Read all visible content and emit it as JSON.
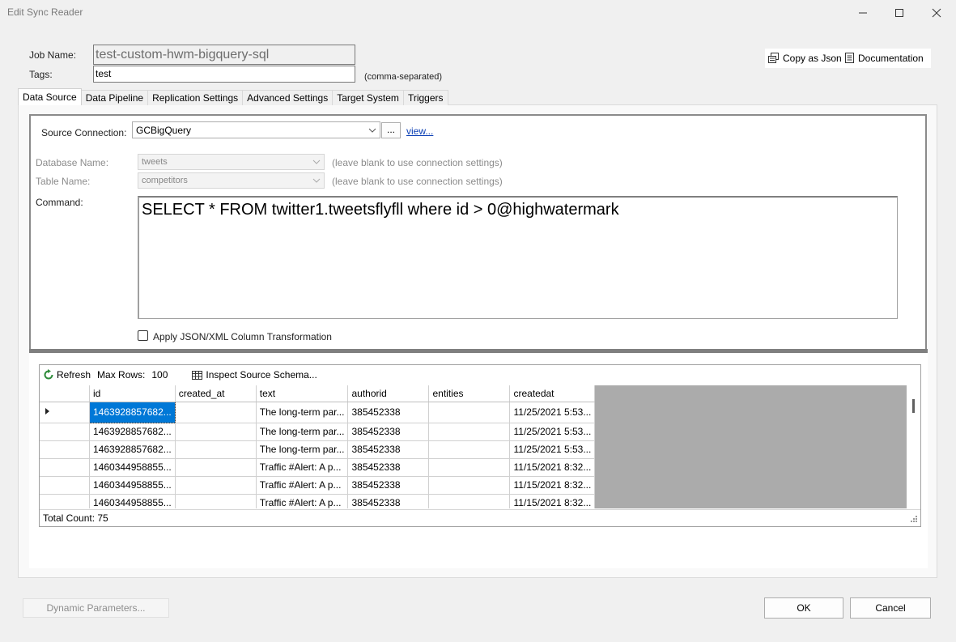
{
  "window": {
    "title": "Edit Sync Reader"
  },
  "header": {
    "job_name_label": "Job Name:",
    "job_name_value": "test-custom-hwm-bigquery-sql",
    "tags_label": "Tags:",
    "tags_value": "test",
    "tags_hint": "(comma-separated)",
    "copy_json_label": "Copy as Json",
    "documentation_label": "Documentation"
  },
  "tabs": [
    {
      "label": "Data Source",
      "active": true
    },
    {
      "label": "Data Pipeline",
      "active": false
    },
    {
      "label": "Replication Settings",
      "active": false
    },
    {
      "label": "Advanced Settings",
      "active": false
    },
    {
      "label": "Target System",
      "active": false
    },
    {
      "label": "Triggers",
      "active": false
    }
  ],
  "data_source": {
    "source_connection_label": "Source Connection:",
    "source_connection_value": "GCBigQuery",
    "browse_button": "...",
    "view_link": "view...",
    "database_name_label": "Database Name:",
    "database_name_value": "tweets",
    "database_hint": "(leave blank to use connection settings)",
    "table_name_label": "Table Name:",
    "table_name_value": "competitors",
    "table_hint": "(leave blank to use connection settings)",
    "command_label": "Command:",
    "command_value": "SELECT * FROM twitter1.tweetsflyfll where id > 0@highwatermark",
    "transform_checkbox_label": "Apply JSON/XML Column Transformation",
    "transform_checked": false
  },
  "grid_toolbar": {
    "refresh_label": "Refresh",
    "max_rows_label": "Max Rows:",
    "max_rows_value": "100",
    "inspect_label": "Inspect Source Schema..."
  },
  "grid": {
    "columns": [
      "id",
      "created_at",
      "text",
      "authorid",
      "entities",
      "createdat"
    ],
    "rows": [
      [
        "1463928857682...",
        "",
        "The long-term par...",
        "385452338",
        "",
        "11/25/2021 5:53..."
      ],
      [
        "1463928857682...",
        "",
        "The long-term par...",
        "385452338",
        "",
        "11/25/2021 5:53..."
      ],
      [
        "1463928857682...",
        "",
        "The long-term par...",
        "385452338",
        "",
        "11/25/2021 5:53..."
      ],
      [
        "1460344958855...",
        "",
        "Traffic #Alert: A p...",
        "385452338",
        "",
        "11/15/2021 8:32..."
      ],
      [
        "1460344958855...",
        "",
        "Traffic #Alert: A p...",
        "385452338",
        "",
        "11/15/2021 8:32..."
      ],
      [
        "1460344958855...",
        "",
        "Traffic #Alert: A p...",
        "385452338",
        "",
        "11/15/2021 8:32..."
      ]
    ],
    "total_count_label": "Total Count: 75"
  },
  "footer": {
    "dynamic_params_label": "Dynamic Parameters...",
    "ok_label": "OK",
    "cancel_label": "Cancel"
  },
  "colors": {
    "selection": "#0078d7",
    "link": "#0b3fb5",
    "refresh_icon": "#2e8b3a"
  },
  "icons": [
    "minimize-icon",
    "maximize-icon",
    "close-icon",
    "copy-icon",
    "document-icon",
    "refresh-icon",
    "table-icon",
    "chevron-down-icon",
    "row-pointer-icon",
    "resize-grip-icon"
  ]
}
